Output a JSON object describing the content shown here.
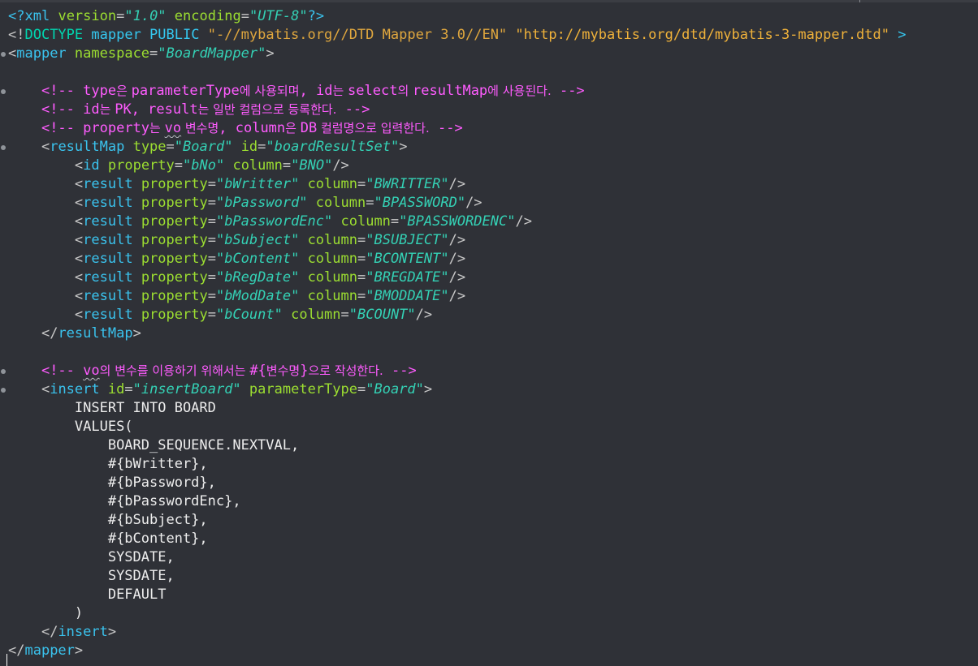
{
  "xml_decl": {
    "open": "<?",
    "tag": "xml",
    "version_attr": "version",
    "version_val": "\"1.0\"",
    "encoding_attr": "encoding",
    "encoding_val": "\"UTF-8\"",
    "close": "?>"
  },
  "doctype": {
    "open": "<!",
    "keyword": "DOCTYPE",
    "rest": "mapper PUBLIC",
    "public_id": "\"-//mybatis.org//DTD Mapper 3.0//EN\"",
    "system_id": "\"http://mybatis.org/dtd/mybatis-3-mapper.dtd\"",
    "close": ">"
  },
  "mapper_open": {
    "tag": "mapper",
    "attr": "namespace",
    "value": "\"BoardMapper\""
  },
  "comments": {
    "c1_a": "type",
    "c1_b": "은 ",
    "c1_c": "parameterType",
    "c1_d": "에 사용되며",
    "c1_e": ", id",
    "c1_f": "는 ",
    "c1_g": "select",
    "c1_h": "의 ",
    "c1_i": "resultMap",
    "c1_j": "에 사용된다.",
    "c2_a": "id",
    "c2_b": "는 ",
    "c2_c": "PK, result",
    "c2_d": "는 일반 컬럼으로 등록한다.",
    "c3_a": "property",
    "c3_b": "는 ",
    "c3_c": "vo",
    "c3_d": " 변수명",
    "c3_e": ", column",
    "c3_f": "은 ",
    "c3_g": "DB",
    "c3_h": " 컬럼명으로 입력한다.",
    "c4_a": "vo",
    "c4_b": "의 변수를 이용하기 위해서는 ",
    "c4_c": "#{",
    "c4_d": "변수명",
    "c4_e": "}",
    "c4_f": "으로 작성한다."
  },
  "resultMap": {
    "tag": "resultMap",
    "type_attr": "type",
    "type_val": "\"Board\"",
    "id_attr": "id",
    "id_val": "\"boardResultSet\"",
    "id_row": {
      "tag": "id",
      "property": "\"bNo\"",
      "column": "\"BNO\""
    },
    "results": [
      {
        "property": "\"bWritter\"",
        "column": "\"BWRITTER\""
      },
      {
        "property": "\"bPassword\"",
        "column": "\"BPASSWORD\""
      },
      {
        "property": "\"bPasswordEnc\"",
        "column": "\"BPASSWORDENC\""
      },
      {
        "property": "\"bSubject\"",
        "column": "\"BSUBJECT\""
      },
      {
        "property": "\"bContent\"",
        "column": "\"BCONTENT\""
      },
      {
        "property": "\"bRegDate\"",
        "column": "\"BREGDATE\""
      },
      {
        "property": "\"bModDate\"",
        "column": "\"BMODDATE\""
      },
      {
        "property": "\"bCount\"",
        "column": "\"BCOUNT\""
      }
    ],
    "result_tag": "result",
    "property_attr": "property",
    "column_attr": "column"
  },
  "insert": {
    "tag": "insert",
    "id_attr": "id",
    "id_val": "\"insertBoard\"",
    "ptype_attr": "parameterType",
    "ptype_val": "\"Board\"",
    "sql": [
      "INSERT INTO BOARD",
      "VALUES(",
      "BOARD_SEQUENCE.NEXTVAL,",
      "#{bWritter},",
      "#{bPassword},",
      "#{bPasswordEnc},",
      "#{bSubject},",
      "#{bContent},",
      "SYSDATE,",
      "SYSDATE,",
      "DEFAULT",
      ")"
    ]
  },
  "mapper_close_tag": "mapper"
}
